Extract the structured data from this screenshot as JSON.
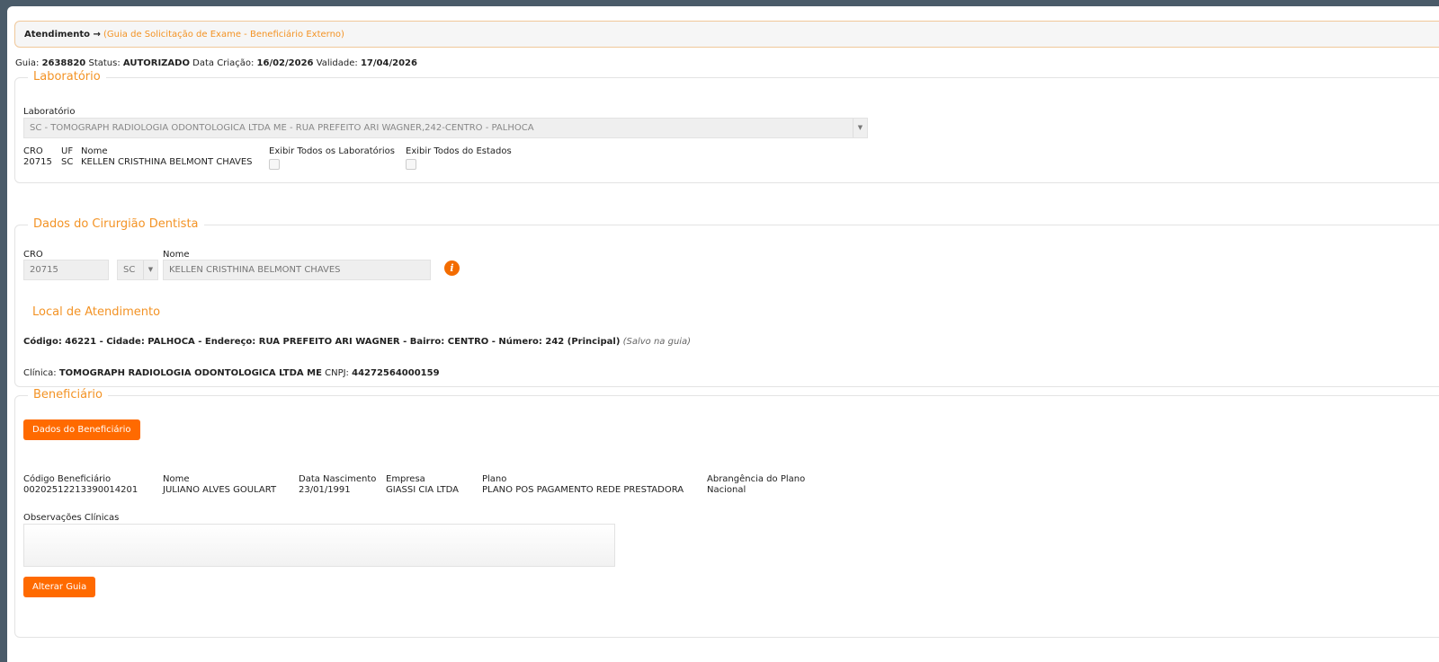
{
  "breadcrumb": {
    "root": "Atendimento →",
    "current": "(Guia de Solicitação de Exame - Beneficiário Externo)"
  },
  "summary": {
    "guia_label": "Guia:",
    "guia": "2638820",
    "status_label": "Status:",
    "status": "AUTORIZADO",
    "criacao_label": "Data Criação:",
    "criacao": "16/02/2026",
    "validade_label": "Validade:",
    "validade": "17/04/2026"
  },
  "laboratorio": {
    "legend": "Laboratório",
    "select_label": "Laboratório",
    "select_value": "SC - TOMOGRAPH RADIOLOGIA ODONTOLOGICA LTDA ME - RUA PREFEITO ARI WAGNER,242-CENTRO - PALHOCA",
    "cro_label": "CRO",
    "cro": "20715",
    "uf_label": "UF",
    "uf": "SC",
    "nome_label": "Nome",
    "nome": "KELLEN CRISTHINA BELMONT CHAVES",
    "show_all_labs": "Exibir Todos os Laboratórios",
    "show_all_states": "Exibir Todos do Estados"
  },
  "dentista": {
    "legend": "Dados do Cirurgião Dentista",
    "cro_label": "CRO",
    "cro": "20715",
    "uf": "SC",
    "nome_label": "Nome",
    "nome": "KELLEN CRISTHINA BELMONT CHAVES",
    "local_title": "Local de Atendimento",
    "local_text": "Código: 46221 - Cidade: PALHOCA - Endereço: RUA PREFEITO ARI WAGNER - Bairro: CENTRO - Número: 242 (Principal)",
    "local_note": "(Salvo na guia)",
    "clinica_label": "Clínica:",
    "clinica": "TOMOGRAPH RADIOLOGIA ODONTOLOGICA LTDA ME",
    "cnpj_label": "CNPJ:",
    "cnpj": "44272564000159"
  },
  "beneficiario": {
    "legend": "Beneficiário",
    "button": "Dados do Beneficiário",
    "fields": [
      {
        "label": "Código Beneficiário",
        "value": "00202512213390014201"
      },
      {
        "label": "Nome",
        "value": "JULIANO ALVES GOULART"
      },
      {
        "label": "Data Nascimento",
        "value": "23/01/1991"
      },
      {
        "label": "Empresa",
        "value": "GIASSI CIA LTDA"
      },
      {
        "label": "Plano",
        "value": "PLANO POS PAGAMENTO REDE PRESTADORA"
      },
      {
        "label": "Abrangência do Plano",
        "value": "Nacional"
      }
    ],
    "obs_label": "Observações Clínicas",
    "obs_value": "",
    "alter_button": "Alterar Guia"
  }
}
